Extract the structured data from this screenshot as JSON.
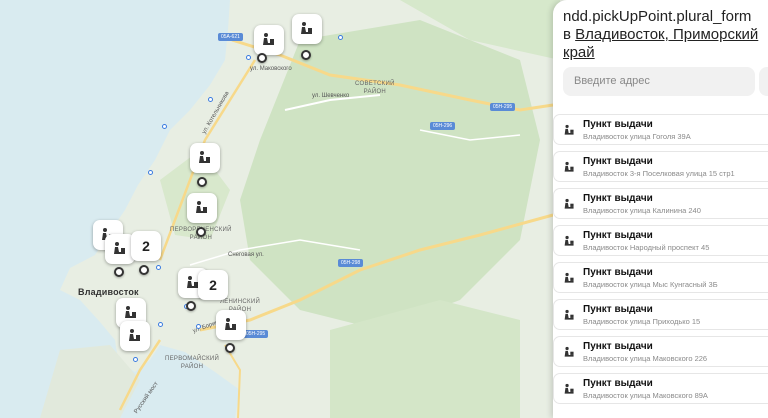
{
  "map": {
    "city_label": "Владивосток",
    "districts": [
      "СОВЕТСКИЙ\nРАЙОН",
      "ПЕРВОРЕЧЕНСКИЙ\nРАЙОН",
      "ПЕРВОМАЙСКИЙ\nРАЙОН",
      "ЛЕНИНСКИЙ\nРАЙОН"
    ],
    "streets": [
      "ул. Маковского",
      "ул. Шевченко",
      "ул. Котельникова",
      "Снеговая ул.",
      "ул. Борисенко",
      "Русский мост"
    ],
    "road_badges": [
      "05А-621",
      "05Н-295",
      "05Н-296",
      "05Н-298",
      "05Н-295"
    ],
    "clusters": [
      "2",
      "2"
    ],
    "colors": {
      "water": "#d9ebf0",
      "land": "#e8eee3",
      "green": "#cfe3c3",
      "road": "#f7d98a",
      "pin_border": "#333333"
    }
  },
  "panel": {
    "title": "ndd.pickUpPoint.plural_form",
    "title_prefix": "в",
    "location": "Владивосток, Приморский край",
    "search_placeholder": "Введите адрес",
    "items": [
      {
        "name": "Пункт выдачи",
        "address": "Владивосток улица Гоголя 39А"
      },
      {
        "name": "Пункт выдачи",
        "address": "Владивосток 3-я Поселковая улица 15 стр1"
      },
      {
        "name": "Пункт выдачи",
        "address": "Владивосток улица Калинина 240"
      },
      {
        "name": "Пункт выдачи",
        "address": "Владивосток Народный проспект 45"
      },
      {
        "name": "Пункт выдачи",
        "address": "Владивосток улица Мыс Кунгасный 3Б"
      },
      {
        "name": "Пункт выдачи",
        "address": "Владивосток улица Приходько 15"
      },
      {
        "name": "Пункт выдачи",
        "address": "Владивосток улица Маковского 226"
      },
      {
        "name": "Пункт выдачи",
        "address": "Владивосток улица Маковского 89А"
      }
    ]
  }
}
